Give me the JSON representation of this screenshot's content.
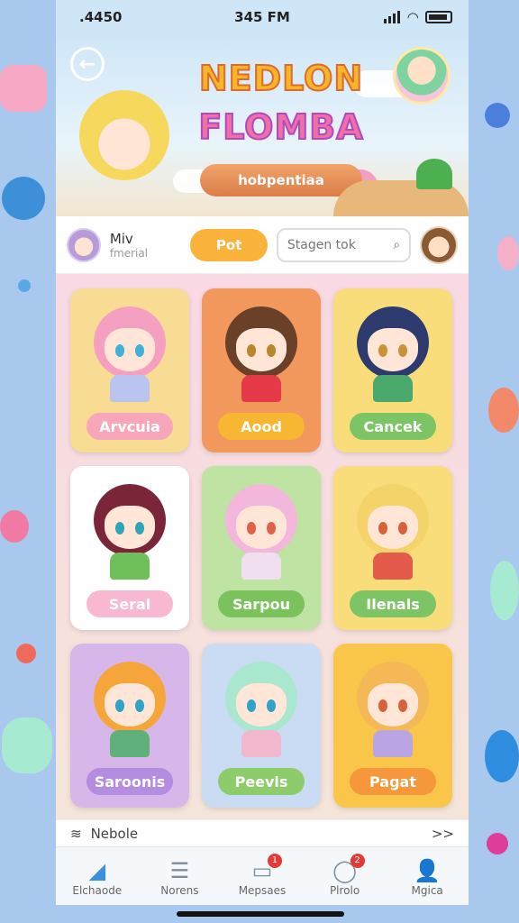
{
  "status": {
    "left": ".4450",
    "time": "345 FM"
  },
  "hero": {
    "title_line1": "NEDLON",
    "title_line2": "FLOMBA",
    "pill": "hobpentiaa"
  },
  "toolbar": {
    "user_name": "Miv",
    "user_sub": "fmerial",
    "post_label": "Pot",
    "search_placeholder": "Stagen tok"
  },
  "cards": [
    {
      "label": "Arvcuia",
      "bg": "#f9dc93",
      "pill": "#f7a7b9",
      "hair": "#f59fc1",
      "eye": "#3fb0d6",
      "outfit": "#b9c4f0"
    },
    {
      "label": "Aood",
      "bg": "#f2985c",
      "pill": "#f7b733",
      "hair": "#6a4028",
      "eye": "#b8862c",
      "outfit": "#e53947"
    },
    {
      "label": "Cancek",
      "bg": "#f9dd7a",
      "pill": "#7cc464",
      "hair": "#2c3a6e",
      "eye": "#c99236",
      "outfit": "#4aa86b"
    },
    {
      "label": "Seral",
      "bg": "#ffffff",
      "pill": "#f7b8d0",
      "hair": "#7a2538",
      "eye": "#2ea6b8",
      "outfit": "#6fbf5a"
    },
    {
      "label": "Sarpou",
      "bg": "#bfe3a3",
      "pill": "#79c25c",
      "hair": "#f3b7dc",
      "eye": "#e0604a",
      "outfit": "#f0e0ef"
    },
    {
      "label": "Ilenals",
      "bg": "#f9dd7a",
      "pill": "#7cc464",
      "hair": "#f4d46a",
      "eye": "#d9613a",
      "outfit": "#e55b4b"
    },
    {
      "label": "Saroonis",
      "bg": "#d7b7ea",
      "pill": "#b48ce0",
      "hair": "#f5a53a",
      "eye": "#2fa4c8",
      "outfit": "#5fb07a"
    },
    {
      "label": "Peevls",
      "bg": "#c9dcf3",
      "pill": "#8ccc6a",
      "hair": "#a9e7cf",
      "eye": "#2fa4c8",
      "outfit": "#f0b7cd"
    },
    {
      "label": "Pagat",
      "bg": "#f9c64a",
      "pill": "#f5973a",
      "hair": "#f4b956",
      "eye": "#d9613a",
      "outfit": "#b9a4e4"
    }
  ],
  "news": {
    "label": "Nebole",
    "more": ">>"
  },
  "tabs": [
    {
      "label": "Elchaode",
      "icon": "paper-plane-icon",
      "glyph": "◢",
      "badge": ""
    },
    {
      "label": "Norens",
      "icon": "list-icon",
      "glyph": "☰",
      "badge": ""
    },
    {
      "label": "Mepsaes",
      "icon": "message-icon",
      "glyph": "▭",
      "badge": "1"
    },
    {
      "label": "Plrolo",
      "icon": "chat-bubble-icon",
      "glyph": "◯",
      "badge": "2"
    },
    {
      "label": "Mgica",
      "icon": "user-icon",
      "glyph": "👤",
      "badge": ""
    }
  ]
}
